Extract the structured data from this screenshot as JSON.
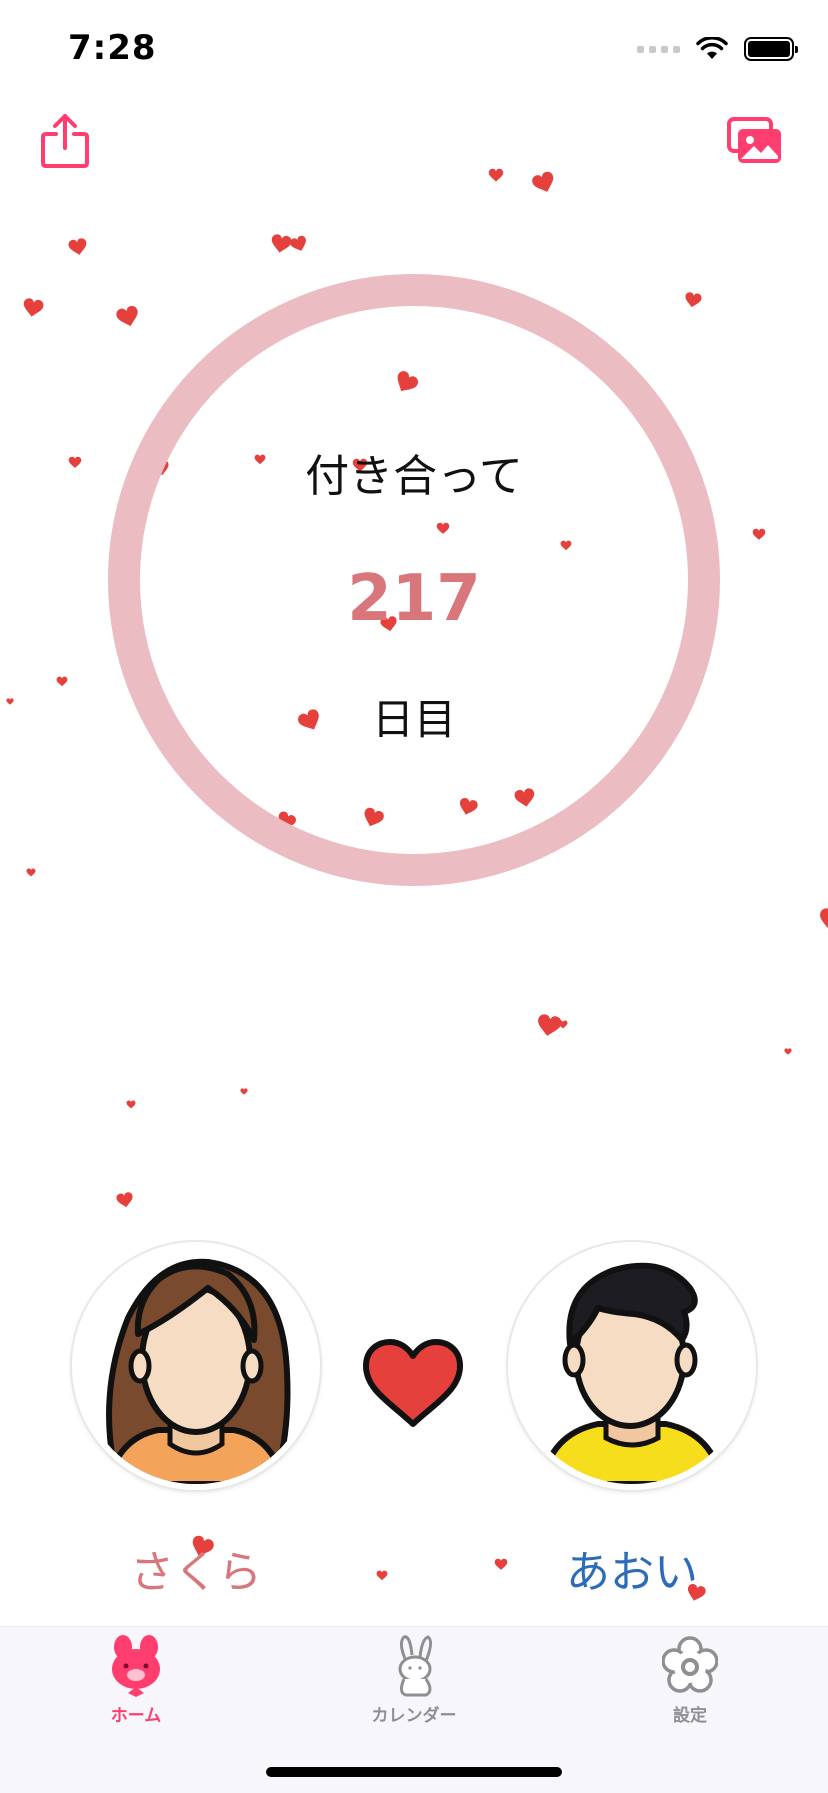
{
  "status_bar": {
    "time": "7:28"
  },
  "header": {
    "share_icon": "share-icon",
    "photo_icon": "photo-gallery-icon"
  },
  "counter": {
    "label": "付き合って",
    "days": "217",
    "suffix": "日目"
  },
  "couple": {
    "left_name": "さくら",
    "right_name": "あおい"
  },
  "tabs": [
    {
      "label": "ホーム",
      "icon": "bunny-icon",
      "active": true
    },
    {
      "label": "カレンダー",
      "icon": "rabbit-outline-icon",
      "active": false
    },
    {
      "label": "設定",
      "icon": "flower-gear-icon",
      "active": false
    }
  ],
  "colors": {
    "accent": "#ff3d6e",
    "ring": "#ecbcc3",
    "days": "#d9767c",
    "heart": "#e5403c",
    "name_right": "#2d6bb8"
  }
}
